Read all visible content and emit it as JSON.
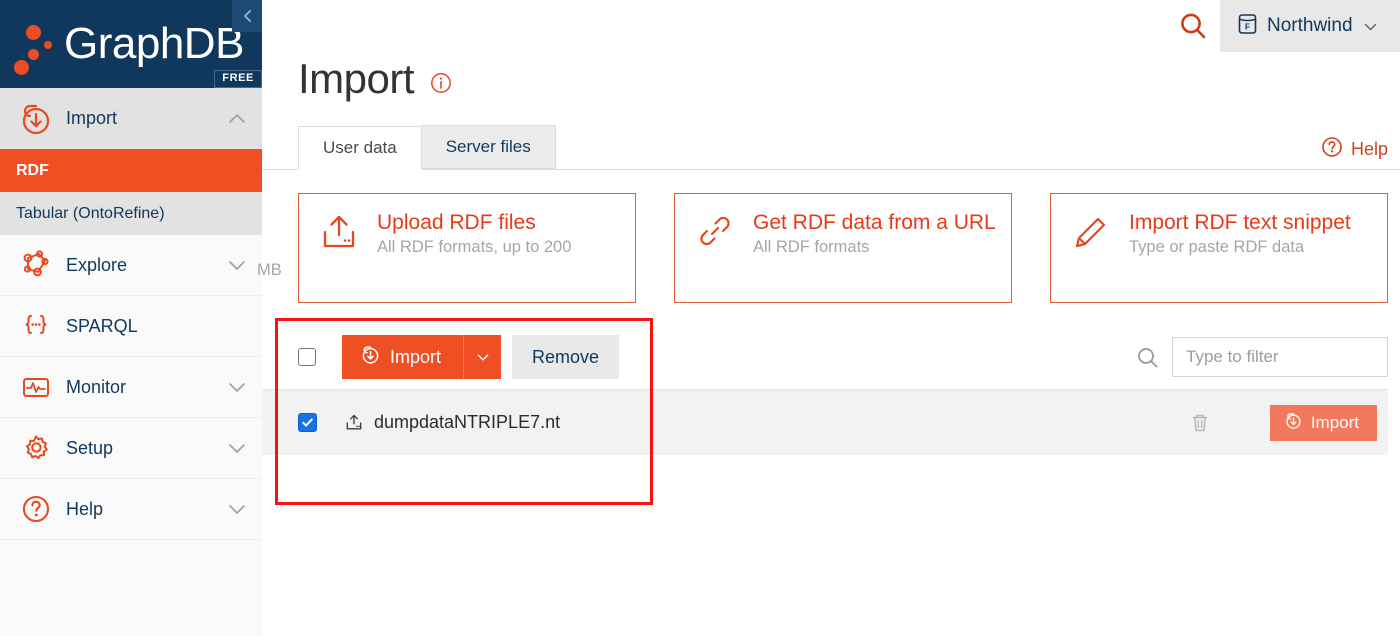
{
  "sidebar": {
    "brand_name": "GraphDB",
    "edition_badge": "FREE",
    "collapse_icon": "chevron-left-icon",
    "items": [
      {
        "label": "Import",
        "icon": "import-download-icon",
        "chevron": "chevron-up-icon",
        "expanded": true
      },
      {
        "label": "Explore",
        "icon": "graph-nodes-icon",
        "chevron": "chevron-down-icon",
        "expanded": false
      },
      {
        "label": "SPARQL",
        "icon": "sparql-braces-icon",
        "chevron": "",
        "expanded": false
      },
      {
        "label": "Monitor",
        "icon": "monitor-pulse-icon",
        "chevron": "chevron-down-icon",
        "expanded": false
      },
      {
        "label": "Setup",
        "icon": "gear-icon",
        "chevron": "chevron-down-icon",
        "expanded": false
      },
      {
        "label": "Help",
        "icon": "question-circle-icon",
        "chevron": "chevron-down-icon",
        "expanded": false
      }
    ],
    "sub_items": [
      {
        "label": "RDF",
        "active": true
      },
      {
        "label": "Tabular (OntoRefine)",
        "active": false
      }
    ]
  },
  "topbar": {
    "search_icon": "search-icon",
    "database_name": "Northwind",
    "database_icon": "database-cylinder-f-icon",
    "database_caret": "chevron-down-icon"
  },
  "header": {
    "title": "Import",
    "info_icon": "info-circle-icon",
    "help_label": "Help",
    "help_icon": "question-circle-icon"
  },
  "tabs": [
    {
      "label": "User data",
      "active": true
    },
    {
      "label": "Server files",
      "active": false
    }
  ],
  "cards": [
    {
      "title": "Upload RDF files",
      "subtitle": "All RDF formats, up to 200",
      "subtitle_wrap": "MB",
      "icon": "upload-server-icon"
    },
    {
      "title": "Get RDF data from a URL",
      "subtitle": "All RDF formats",
      "subtitle_wrap": "",
      "icon": "link-chain-icon"
    },
    {
      "title": "Import RDF text snippet",
      "subtitle": "Type or paste RDF data",
      "subtitle_wrap": "",
      "icon": "pencil-icon"
    }
  ],
  "toolbar": {
    "master_checkbox_checked": false,
    "import_label": "Import",
    "import_icon": "import-download-icon",
    "import_caret_icon": "chevron-down-icon",
    "remove_label": "Remove",
    "filter_placeholder": "Type to filter",
    "filter_value": "",
    "filter_icon": "search-icon"
  },
  "files": {
    "columns": [
      "select",
      "name",
      "delete",
      "action"
    ],
    "rows": [
      {
        "name": "dumpdataNTRIPLE7.nt",
        "checked": true,
        "file_icon": "upload-file-icon",
        "delete_icon": "trash-icon",
        "import_label": "Import",
        "import_icon": "import-download-icon"
      }
    ]
  },
  "colors": {
    "brand_orange": "#f04e23",
    "brand_orange_dark": "#e8391a",
    "navy": "#10375c",
    "annotation_red": "#f51313",
    "row_background": "#f2f2f2",
    "checkbox_blue": "#1673e6"
  }
}
